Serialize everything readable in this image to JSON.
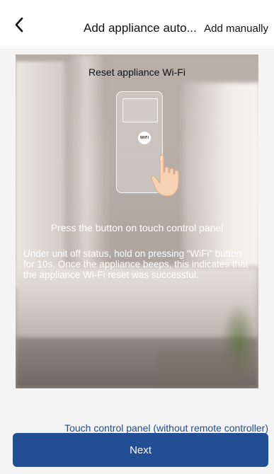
{
  "header": {
    "title": "Add appliance auto...",
    "add_manually": "Add manually",
    "back_icon": "chevron-left-icon"
  },
  "illustration": {
    "title": "Reset appliance Wi-Fi",
    "wifi_button_label": "WiFi",
    "caption": "Press the button on touch control panel",
    "instructions": "Under unit off status, hold on pressing “WiFi” button for 10s. Once the appliance beeps, this indicates that the appliance Wi-Fi reset was successful."
  },
  "panel_type": "Touch control panel (without remote controller)",
  "next_label": "Next",
  "colors": {
    "primary": "#224f93",
    "link": "#1f4b8f",
    "background": "#f4f4f4"
  }
}
